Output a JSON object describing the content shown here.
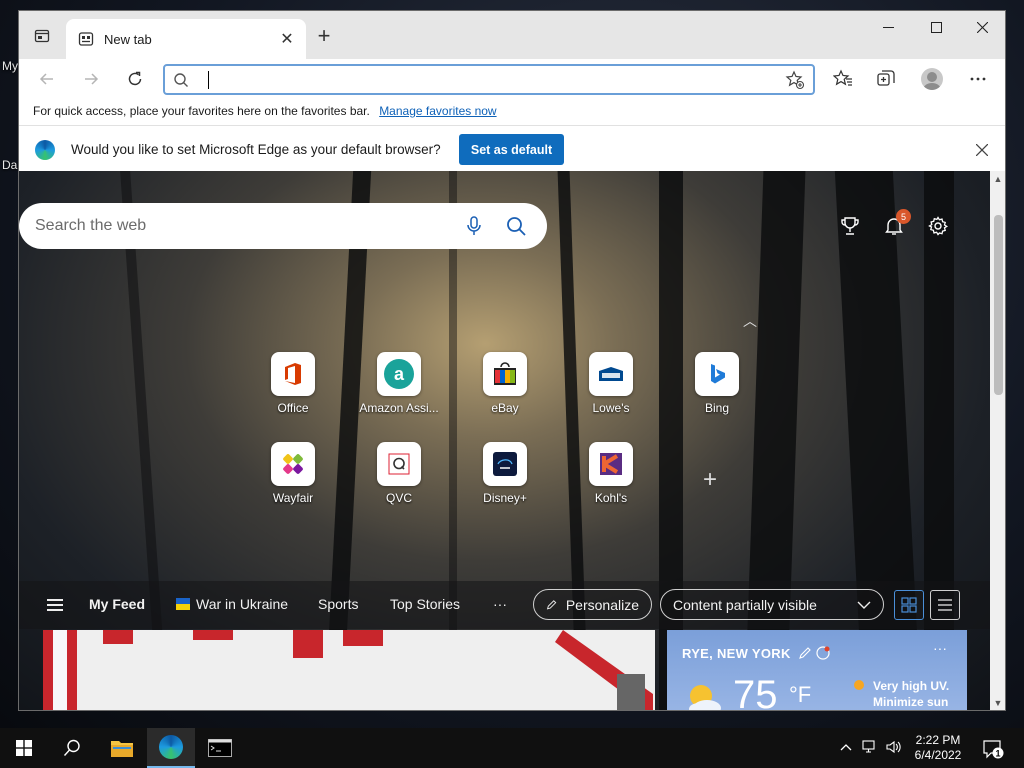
{
  "desktop": {
    "label_top": "My",
    "label_mid": "Da"
  },
  "browser": {
    "tab": {
      "title": "New tab"
    },
    "window_controls": {
      "minimize": "—",
      "maximize": "☐",
      "close": "✕"
    },
    "address_bar": {
      "value": "",
      "placeholder": ""
    },
    "favorites_bar": {
      "text": "For quick access, place your favorites here on the favorites bar.",
      "link": "Manage favorites now"
    },
    "infobar": {
      "text": "Would you like to set Microsoft Edge as your default browser?",
      "button": "Set as default"
    }
  },
  "newtab": {
    "search_placeholder": "Search the web",
    "notification_count": "5",
    "quick_links": [
      {
        "label": "Office",
        "icon": "office-icon",
        "color": "#d83b01"
      },
      {
        "label": "Amazon Assi...",
        "icon": "amazon-icon",
        "color": "#1aa39a"
      },
      {
        "label": "eBay",
        "icon": "ebay-icon",
        "color": "#e53238"
      },
      {
        "label": "Lowe's",
        "icon": "lowes-icon",
        "color": "#004990"
      },
      {
        "label": "Bing",
        "icon": "bing-icon",
        "color": "#0c8484"
      },
      {
        "label": "Wayfair",
        "icon": "wayfair-icon",
        "color": "#7b189f"
      },
      {
        "label": "QVC",
        "icon": "qvc-icon",
        "color": "#333333"
      },
      {
        "label": "Disney+",
        "icon": "disney-icon",
        "color": "#0d1a3d"
      },
      {
        "label": "Kohl's",
        "icon": "kohls-icon",
        "color": "#5a2c82"
      }
    ],
    "feed": {
      "my_feed": "My Feed",
      "war_in_ukraine": "War in Ukraine",
      "sports": "Sports",
      "top_stories": "Top Stories",
      "more": "···",
      "personalize": "Personalize",
      "content_visibility": "Content partially visible"
    },
    "weather": {
      "location": "RYE, NEW YORK",
      "temperature": "75",
      "unit": "°F",
      "uv_line1": "Very high UV.",
      "uv_line2": "Minimize sun",
      "more": "···"
    }
  },
  "taskbar": {
    "time": "2:22 PM",
    "date": "6/4/2022",
    "notifications": "1"
  },
  "colors": {
    "accent": "#0f6cbd",
    "badge": "#d9572b",
    "address_focus": "#6a9fd8"
  }
}
